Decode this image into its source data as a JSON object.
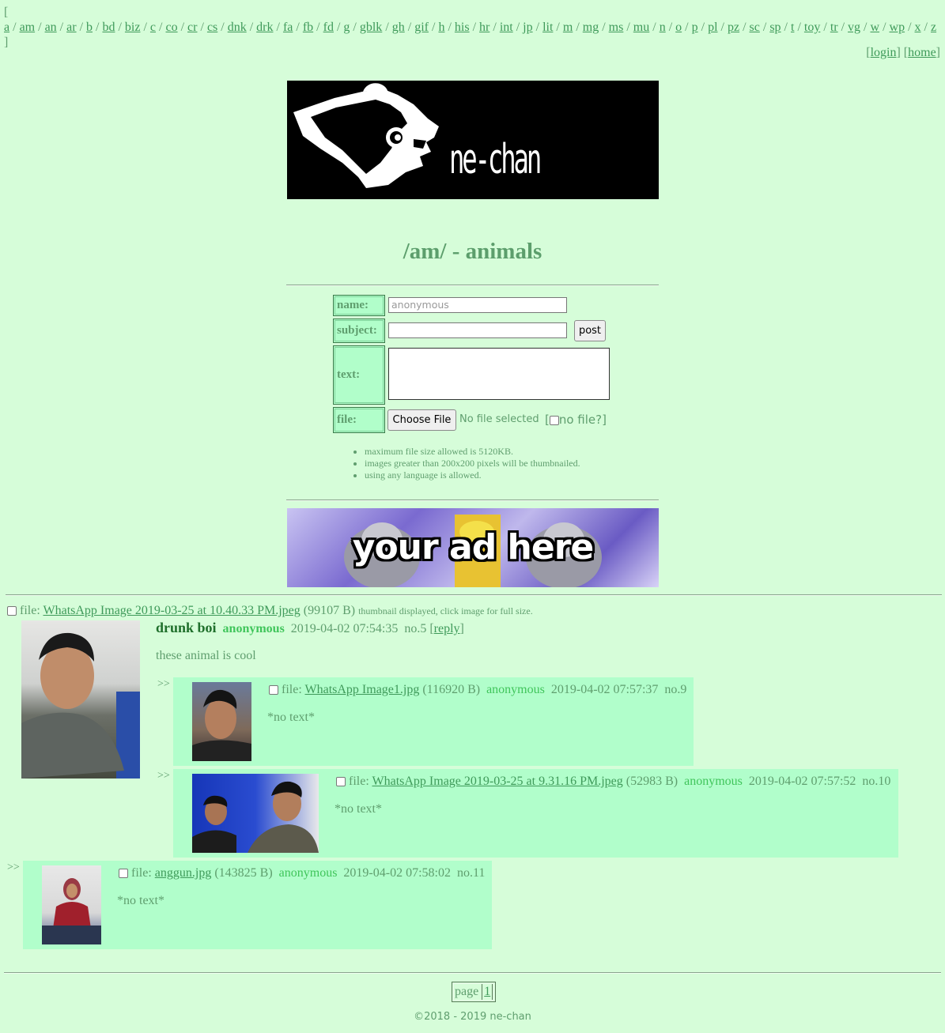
{
  "boardlist": {
    "open": "[",
    "close": "]",
    "boards": [
      "a",
      "am",
      "an",
      "ar",
      "b",
      "bd",
      "biz",
      "c",
      "co",
      "cr",
      "cs",
      "dnk",
      "drk",
      "fa",
      "fb",
      "fd",
      "g",
      "gblk",
      "gh",
      "gif",
      "h",
      "his",
      "hr",
      "int",
      "jp",
      "lit",
      "m",
      "mg",
      "ms",
      "mu",
      "n",
      "o",
      "p",
      "pl",
      "pz",
      "sc",
      "sp",
      "t",
      "toy",
      "tr",
      "vg",
      "w",
      "wp",
      "x",
      "z"
    ]
  },
  "toplinks": {
    "login": "login",
    "home": "home"
  },
  "banner": {
    "text": "ne-chan"
  },
  "board_title": "/am/ - animals",
  "form": {
    "name_label": "name:",
    "name_placeholder": "anonymous",
    "subject_label": "subject:",
    "post_button": "post",
    "text_label": "text:",
    "file_label": "file:",
    "choose_file": "Choose File",
    "no_file_selected": "No file selected",
    "no_file_option": "no file?"
  },
  "rules": [
    "maximum file size allowed is 5120KB.",
    "images greater than 200x200 pixels will be thumbnailed.",
    "using any language is allowed."
  ],
  "ad": {
    "text": "your ad here"
  },
  "thread": {
    "file_prefix": "file:",
    "file_name": "WhatsApp Image 2019-03-25 at 10.40.33 PM.jpeg",
    "file_size": "(99107 B)",
    "thumb_note": "thumbnail displayed, click image for full size.",
    "subject": "drunk boi",
    "poster": "anonymous",
    "date": "2019-04-02 07:54:35",
    "number": "no.5",
    "reply_link": "reply",
    "text": "these animal is cool"
  },
  "replies": [
    {
      "arrow": ">>",
      "file_prefix": "file:",
      "file_name": "WhatsApp Image1.jpg",
      "file_size": "(116920 B)",
      "poster": "anonymous",
      "date": "2019-04-02 07:57:37",
      "number": "no.9",
      "text": "*no text*"
    },
    {
      "arrow": ">>",
      "file_prefix": "file:",
      "file_name": "WhatsApp Image 2019-03-25 at 9.31.16 PM.jpeg",
      "file_size": "(52983 B)",
      "poster": "anonymous",
      "date": "2019-04-02 07:57:52",
      "number": "no.10",
      "text": "*no text*"
    },
    {
      "arrow": ">>",
      "file_prefix": "file:",
      "file_name": "anggun.jpg",
      "file_size": "(143825 B)",
      "poster": "anonymous",
      "date": "2019-04-02 07:58:02",
      "number": "no.11",
      "text": "*no text*"
    }
  ],
  "pagination": {
    "label": "page",
    "current": "1"
  },
  "footer": "©2018 - 2019 ne-chan",
  "colors": {
    "background": "#d6fdd9",
    "reply_bg": "#b1fecb",
    "link": "#3f9a5a",
    "poster": "#40c55b",
    "subject": "#1f6f2b"
  }
}
